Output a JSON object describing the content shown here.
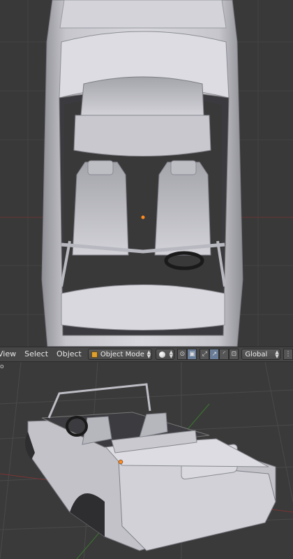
{
  "header": {
    "menu": [
      {
        "label": "View"
      },
      {
        "label": "Select"
      },
      {
        "label": "Object"
      }
    ],
    "mode_dropdown": {
      "value": "Object Mode",
      "icon": "cube-icon"
    },
    "shading_dropdown": {
      "icon": "solid-shading-icon"
    },
    "orientation_dropdown": {
      "value": "Global"
    },
    "pivot_icons": [
      "pivot-icon",
      "bounding-box-icon"
    ],
    "manipulator_icons": [
      "manipulator-toggle-icon",
      "translate-icon",
      "rotate-icon",
      "scale-icon"
    ]
  },
  "bottom_viewport": {
    "marker": "o"
  },
  "colors": {
    "viewport_bg": "#393939",
    "header_bg": "#464646",
    "model": "#c9c9cf",
    "origin": "#ff8a1f",
    "x_axis": "#8a3a3a",
    "y_axis": "#4a8a3a"
  }
}
